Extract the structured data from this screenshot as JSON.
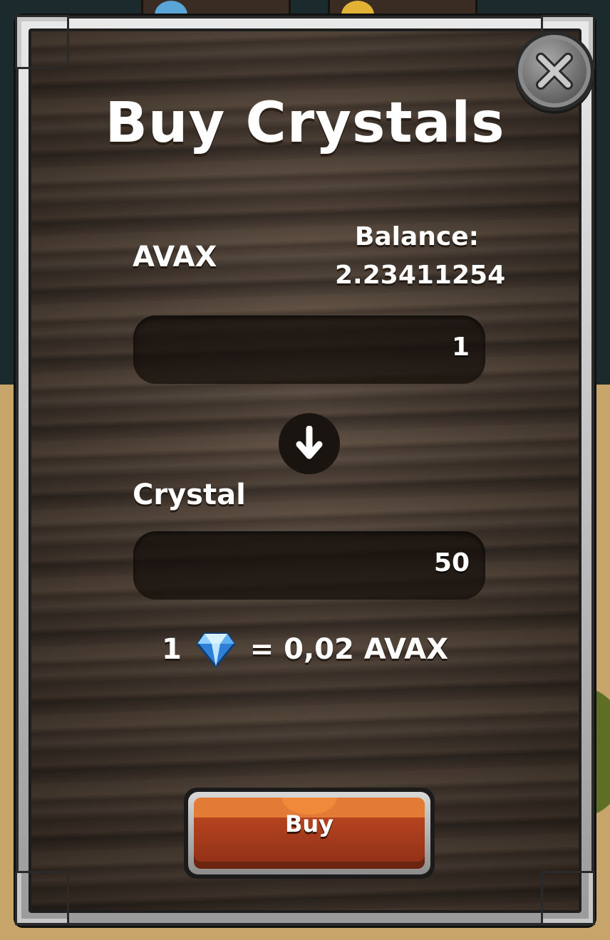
{
  "dialog": {
    "title": "Buy Crystals",
    "close_icon": "close-x-icon"
  },
  "source": {
    "currency_label": "AVAX",
    "balance_label": "Balance:",
    "balance_value": "2.23411254",
    "amount": "1"
  },
  "swap_icon": "arrow-down-icon",
  "target": {
    "currency_label": "Crystal",
    "amount": "50"
  },
  "rate": {
    "left": "1",
    "icon": "crystal-gem-icon",
    "right": "= 0,02 AVAX"
  },
  "actions": {
    "buy_label": "Buy"
  },
  "colors": {
    "panel_bg": "#4a3b30",
    "field_bg": "#1a140f",
    "text": "#ffffff",
    "buy_button": "#b5431f",
    "frame": "#c8c8c8"
  }
}
